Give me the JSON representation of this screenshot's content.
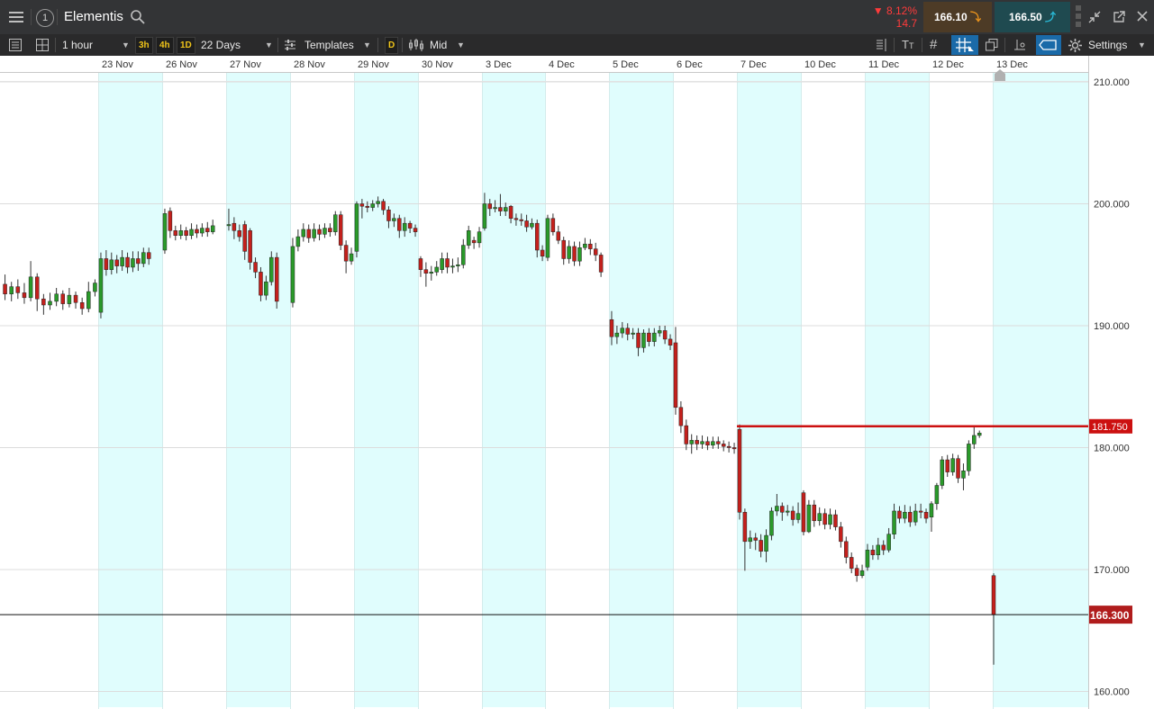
{
  "header": {
    "menu_icon": "hamburger-menu-icon",
    "instrument_number": "1",
    "instrument_name": "Elementis",
    "search_icon": "search-icon",
    "change_percent": "▼ 8.12%",
    "change_points": "14.7",
    "sell_price": "166.10",
    "buy_price": "166.50",
    "colors": {
      "sell_bg": "#4d3b26",
      "sell_arrow": "#e8921c",
      "buy_bg": "#1f4a50",
      "buy_arrow": "#29b9d6",
      "down_red": "#ff3b3b"
    }
  },
  "toolbar": {
    "timeframe": "1 hour",
    "quick_intervals": [
      "3h",
      "4h",
      "1D"
    ],
    "range": "22 Days",
    "templates_label": "Templates",
    "d_button": "D",
    "price_type": "Mid",
    "settings_label": "Settings"
  },
  "chart_data": {
    "type": "candlestick",
    "x_tick_labels": [
      "23 Nov",
      "26 Nov",
      "27 Nov",
      "28 Nov",
      "29 Nov",
      "30 Nov",
      "3 Dec",
      "4 Dec",
      "5 Dec",
      "6 Dec",
      "7 Dec",
      "10 Dec",
      "11 Dec",
      "12 Dec",
      "13 Dec"
    ],
    "y_tick_labels": [
      "210.000",
      "200.000",
      "190.000",
      "180.000",
      "170.000",
      "160.000"
    ],
    "ylim": [
      159.5,
      211.5
    ],
    "grid": true,
    "alternate_day_shading": "#e0fdfd",
    "horizontal_line": {
      "value": 181.75,
      "label": "181.750",
      "color": "#cc1010"
    },
    "last_price": {
      "value": 166.3,
      "label": "166.300"
    },
    "up_color": "#2a9a2a",
    "down_color": "#c4201c",
    "candles": [
      [
        0,
        193.4,
        192.6,
        194.2,
        192.1
      ],
      [
        0,
        192.6,
        193.2,
        193.6,
        192.0
      ],
      [
        0,
        193.2,
        192.7,
        193.8,
        192.2
      ],
      [
        0,
        192.7,
        192.3,
        193.5,
        191.8
      ],
      [
        0,
        192.3,
        194.0,
        195.3,
        192.0
      ],
      [
        0,
        194.0,
        192.2,
        194.3,
        191.2
      ],
      [
        0,
        192.2,
        191.7,
        192.6,
        190.9
      ],
      [
        0,
        191.7,
        192.0,
        192.7,
        191.3
      ],
      [
        0,
        192.0,
        192.6,
        193.1,
        191.6
      ],
      [
        0,
        192.6,
        191.8,
        192.9,
        191.3
      ],
      [
        0,
        191.8,
        192.5,
        193.1,
        191.5
      ],
      [
        0,
        192.5,
        191.9,
        192.8,
        191.4
      ],
      [
        0,
        191.9,
        191.4,
        192.3,
        190.9
      ],
      [
        0,
        191.4,
        192.8,
        193.6,
        191.1
      ],
      [
        0,
        192.8,
        193.5,
        193.8,
        192.4
      ],
      [
        1,
        191.1,
        195.5,
        196.0,
        190.6
      ],
      [
        1,
        195.5,
        194.6,
        196.2,
        194.1
      ],
      [
        1,
        194.6,
        195.4,
        196.0,
        194.2
      ],
      [
        1,
        195.4,
        194.9,
        195.8,
        194.3
      ],
      [
        1,
        194.9,
        195.6,
        196.2,
        194.5
      ],
      [
        1,
        195.6,
        194.8,
        196.0,
        194.3
      ],
      [
        1,
        194.8,
        195.5,
        196.1,
        194.4
      ],
      [
        1,
        195.5,
        195.1,
        196.1,
        194.5
      ],
      [
        1,
        195.1,
        196.0,
        196.4,
        194.8
      ],
      [
        1,
        196.0,
        195.5,
        196.4,
        195.0
      ],
      [
        2,
        196.2,
        199.2,
        199.6,
        195.9
      ],
      [
        2,
        199.4,
        197.8,
        199.7,
        197.2
      ],
      [
        2,
        197.8,
        197.4,
        198.2,
        197.0
      ],
      [
        2,
        197.4,
        197.8,
        198.3,
        197.1
      ],
      [
        2,
        197.8,
        197.4,
        198.1,
        197.0
      ],
      [
        2,
        197.4,
        197.9,
        198.4,
        197.1
      ],
      [
        2,
        197.9,
        197.6,
        198.3,
        197.2
      ],
      [
        2,
        197.6,
        198.0,
        198.4,
        197.3
      ],
      [
        2,
        198.0,
        197.7,
        198.5,
        197.3
      ],
      [
        2,
        197.7,
        198.2,
        198.7,
        197.5
      ],
      [
        3,
        198.2,
        198.3,
        199.6,
        197.8
      ],
      [
        3,
        198.4,
        197.8,
        198.9,
        197.1
      ],
      [
        3,
        197.8,
        197.3,
        198.3,
        196.9
      ],
      [
        3,
        198.3,
        196.1,
        198.6,
        195.4
      ],
      [
        3,
        197.8,
        195.2,
        198.0,
        194.6
      ],
      [
        3,
        195.2,
        194.4,
        195.6,
        193.9
      ],
      [
        3,
        194.4,
        192.5,
        194.8,
        192.0
      ],
      [
        3,
        192.5,
        193.6,
        194.1,
        192.1
      ],
      [
        3,
        193.6,
        195.6,
        196.1,
        193.3
      ],
      [
        3,
        195.6,
        192.0,
        196.0,
        191.4
      ],
      [
        4,
        191.9,
        196.5,
        197.2,
        191.5
      ],
      [
        4,
        196.5,
        197.3,
        197.9,
        196.1
      ],
      [
        4,
        197.3,
        197.9,
        198.4,
        196.9
      ],
      [
        4,
        197.9,
        197.2,
        198.3,
        196.8
      ],
      [
        4,
        197.2,
        197.9,
        198.4,
        196.9
      ],
      [
        4,
        197.9,
        197.5,
        198.3,
        197.0
      ],
      [
        4,
        197.5,
        198.0,
        198.4,
        197.2
      ],
      [
        4,
        198.0,
        197.7,
        198.4,
        197.3
      ],
      [
        4,
        197.7,
        199.1,
        199.4,
        197.4
      ],
      [
        4,
        199.1,
        196.6,
        199.4,
        196.2
      ],
      [
        4,
        196.6,
        195.3,
        197.0,
        194.3
      ],
      [
        4,
        195.3,
        195.9,
        196.4,
        195.0
      ],
      [
        5,
        196.1,
        200.0,
        200.2,
        195.6
      ],
      [
        5,
        200.0,
        199.8,
        200.4,
        198.8
      ],
      [
        5,
        199.8,
        199.7,
        200.2,
        199.3
      ],
      [
        5,
        199.7,
        200.0,
        200.3,
        199.4
      ],
      [
        5,
        200.0,
        200.2,
        200.6,
        199.7
      ],
      [
        5,
        200.2,
        199.5,
        200.4,
        199.1
      ],
      [
        5,
        199.5,
        198.6,
        199.8,
        198.0
      ],
      [
        5,
        198.6,
        198.8,
        199.2,
        198.1
      ],
      [
        5,
        198.8,
        197.8,
        199.1,
        197.2
      ],
      [
        5,
        197.8,
        198.4,
        198.9,
        197.3
      ],
      [
        5,
        198.4,
        198.0,
        198.6,
        197.6
      ],
      [
        5,
        198.0,
        197.7,
        198.3,
        197.3
      ],
      [
        6,
        195.5,
        194.6,
        195.7,
        194.0
      ],
      [
        6,
        194.6,
        194.3,
        195.2,
        193.2
      ],
      [
        6,
        194.3,
        194.4,
        194.9,
        193.7
      ],
      [
        6,
        194.4,
        194.8,
        195.3,
        194.1
      ],
      [
        6,
        194.6,
        195.5,
        196.0,
        194.3
      ],
      [
        6,
        195.5,
        194.8,
        196.0,
        194.3
      ],
      [
        6,
        194.8,
        194.9,
        195.5,
        194.3
      ],
      [
        6,
        194.9,
        195.0,
        195.6,
        194.4
      ],
      [
        6,
        195.0,
        196.6,
        197.1,
        194.7
      ],
      [
        6,
        196.6,
        197.8,
        198.2,
        196.3
      ],
      [
        6,
        197.0,
        196.8,
        197.3,
        196.3
      ],
      [
        6,
        196.8,
        197.7,
        198.1,
        196.4
      ],
      [
        7,
        198.0,
        200.0,
        200.9,
        197.8
      ],
      [
        7,
        200.0,
        199.6,
        200.4,
        199.0
      ],
      [
        7,
        199.6,
        199.7,
        200.3,
        199.3
      ],
      [
        7,
        199.7,
        199.4,
        200.8,
        199.0
      ],
      [
        7,
        199.4,
        199.7,
        200.1,
        199.0
      ],
      [
        7,
        199.8,
        198.8,
        199.9,
        198.4
      ],
      [
        7,
        198.8,
        198.7,
        199.2,
        198.2
      ],
      [
        7,
        198.7,
        198.6,
        199.2,
        198.2
      ],
      [
        7,
        198.6,
        198.1,
        199.1,
        197.7
      ],
      [
        7,
        198.1,
        198.4,
        198.8,
        197.9
      ],
      [
        7,
        198.4,
        196.2,
        198.7,
        195.6
      ],
      [
        7,
        196.2,
        195.7,
        196.6,
        195.3
      ],
      [
        8,
        195.6,
        198.8,
        199.1,
        195.3
      ],
      [
        8,
        198.8,
        197.7,
        199.2,
        197.4
      ],
      [
        8,
        197.7,
        197.0,
        198.2,
        196.7
      ],
      [
        8,
        197.0,
        195.5,
        197.3,
        195.0
      ],
      [
        8,
        195.5,
        196.5,
        197.0,
        195.1
      ],
      [
        8,
        196.5,
        195.3,
        196.9,
        194.9
      ],
      [
        8,
        195.3,
        196.4,
        196.9,
        194.9
      ],
      [
        8,
        196.4,
        196.7,
        197.2,
        196.2
      ],
      [
        8,
        196.7,
        196.3,
        197.1,
        195.8
      ],
      [
        8,
        196.3,
        195.8,
        196.8,
        195.3
      ],
      [
        8,
        195.8,
        194.4,
        196.0,
        194.0
      ],
      [
        9,
        190.5,
        189.1,
        191.2,
        188.4
      ],
      [
        9,
        189.1,
        189.4,
        190.0,
        188.5
      ],
      [
        9,
        189.4,
        189.8,
        190.3,
        189.0
      ],
      [
        9,
        189.8,
        189.3,
        190.2,
        188.8
      ],
      [
        9,
        189.3,
        189.4,
        189.8,
        188.9
      ],
      [
        9,
        189.4,
        188.2,
        189.8,
        187.5
      ],
      [
        9,
        188.2,
        189.4,
        189.7,
        187.8
      ],
      [
        9,
        189.4,
        188.7,
        189.8,
        188.3
      ],
      [
        9,
        188.7,
        189.4,
        189.8,
        188.3
      ],
      [
        9,
        189.4,
        189.6,
        190.0,
        189.1
      ],
      [
        9,
        189.6,
        188.9,
        190.0,
        188.5
      ],
      [
        9,
        188.9,
        188.4,
        189.3,
        188.0
      ],
      [
        10,
        188.6,
        183.3,
        189.9,
        182.7
      ],
      [
        10,
        183.3,
        181.8,
        183.8,
        181.2
      ],
      [
        10,
        181.8,
        180.3,
        182.3,
        179.8
      ],
      [
        10,
        180.3,
        180.6,
        181.1,
        179.5
      ],
      [
        10,
        180.6,
        180.3,
        181.0,
        179.8
      ],
      [
        10,
        180.3,
        180.5,
        181.0,
        179.9
      ],
      [
        10,
        180.5,
        180.2,
        180.9,
        179.8
      ],
      [
        10,
        180.2,
        180.5,
        180.9,
        179.9
      ],
      [
        10,
        180.5,
        180.3,
        180.9,
        179.9
      ],
      [
        10,
        180.3,
        180.1,
        180.6,
        179.7
      ],
      [
        10,
        180.1,
        180.0,
        180.5,
        179.6
      ],
      [
        10,
        180.0,
        179.9,
        180.4,
        179.5
      ],
      [
        11,
        181.5,
        174.7,
        181.9,
        174.1
      ],
      [
        11,
        174.7,
        172.3,
        175.0,
        169.9
      ],
      [
        11,
        172.3,
        172.6,
        173.2,
        171.7
      ],
      [
        11,
        172.6,
        172.4,
        173.0,
        171.6
      ],
      [
        11,
        172.4,
        171.5,
        172.9,
        171.0
      ],
      [
        11,
        171.5,
        172.8,
        173.3,
        170.6
      ],
      [
        11,
        172.8,
        174.8,
        175.1,
        172.4
      ],
      [
        11,
        174.8,
        175.2,
        176.2,
        174.4
      ],
      [
        11,
        175.2,
        174.7,
        175.5,
        174.0
      ],
      [
        11,
        174.7,
        174.8,
        175.3,
        174.4
      ],
      [
        11,
        174.8,
        174.1,
        175.2,
        173.6
      ],
      [
        11,
        174.1,
        174.6,
        175.5,
        173.8
      ],
      [
        12,
        176.3,
        173.1,
        176.5,
        172.8
      ],
      [
        12,
        173.1,
        175.3,
        175.7,
        173.0
      ],
      [
        12,
        175.3,
        174.0,
        175.7,
        173.5
      ],
      [
        12,
        174.0,
        174.6,
        175.1,
        173.6
      ],
      [
        12,
        174.6,
        173.7,
        175.0,
        173.3
      ],
      [
        12,
        173.7,
        174.5,
        175.0,
        173.3
      ],
      [
        12,
        174.5,
        173.5,
        174.9,
        173.2
      ],
      [
        12,
        173.5,
        172.3,
        173.9,
        171.8
      ],
      [
        12,
        172.3,
        171.0,
        172.7,
        170.5
      ],
      [
        12,
        171.0,
        170.1,
        171.4,
        169.7
      ],
      [
        12,
        170.1,
        169.5,
        170.4,
        169.0
      ],
      [
        12,
        169.5,
        169.9,
        170.4,
        169.3
      ],
      [
        13,
        170.2,
        171.6,
        172.1,
        169.9
      ],
      [
        13,
        171.6,
        171.2,
        172.0,
        170.8
      ],
      [
        13,
        171.2,
        172.0,
        172.6,
        170.8
      ],
      [
        13,
        172.0,
        171.6,
        172.4,
        171.2
      ],
      [
        13,
        171.6,
        172.9,
        173.4,
        171.4
      ],
      [
        13,
        172.9,
        174.8,
        175.4,
        172.5
      ],
      [
        13,
        174.8,
        174.2,
        175.2,
        173.8
      ],
      [
        13,
        174.2,
        174.7,
        175.3,
        173.8
      ],
      [
        13,
        174.7,
        173.9,
        175.2,
        173.5
      ],
      [
        13,
        173.9,
        174.8,
        175.4,
        173.6
      ],
      [
        13,
        174.8,
        174.7,
        175.4,
        174.2
      ],
      [
        13,
        174.7,
        174.2,
        175.0,
        173.8
      ],
      [
        14,
        174.3,
        175.4,
        175.6,
        173.1
      ],
      [
        14,
        175.4,
        176.9,
        177.1,
        174.9
      ],
      [
        14,
        176.9,
        179.0,
        179.3,
        176.6
      ],
      [
        14,
        179.0,
        178.0,
        179.4,
        177.6
      ],
      [
        14,
        178.0,
        179.1,
        179.5,
        177.7
      ],
      [
        14,
        179.1,
        177.5,
        179.4,
        177.1
      ],
      [
        14,
        177.5,
        178.1,
        178.7,
        176.5
      ],
      [
        14,
        178.1,
        180.3,
        180.6,
        177.7
      ],
      [
        14,
        180.3,
        181.0,
        181.7,
        179.9
      ],
      [
        14,
        181.0,
        181.2,
        181.4,
        180.8
      ],
      [
        15,
        169.5,
        166.3,
        169.7,
        162.2
      ]
    ]
  }
}
